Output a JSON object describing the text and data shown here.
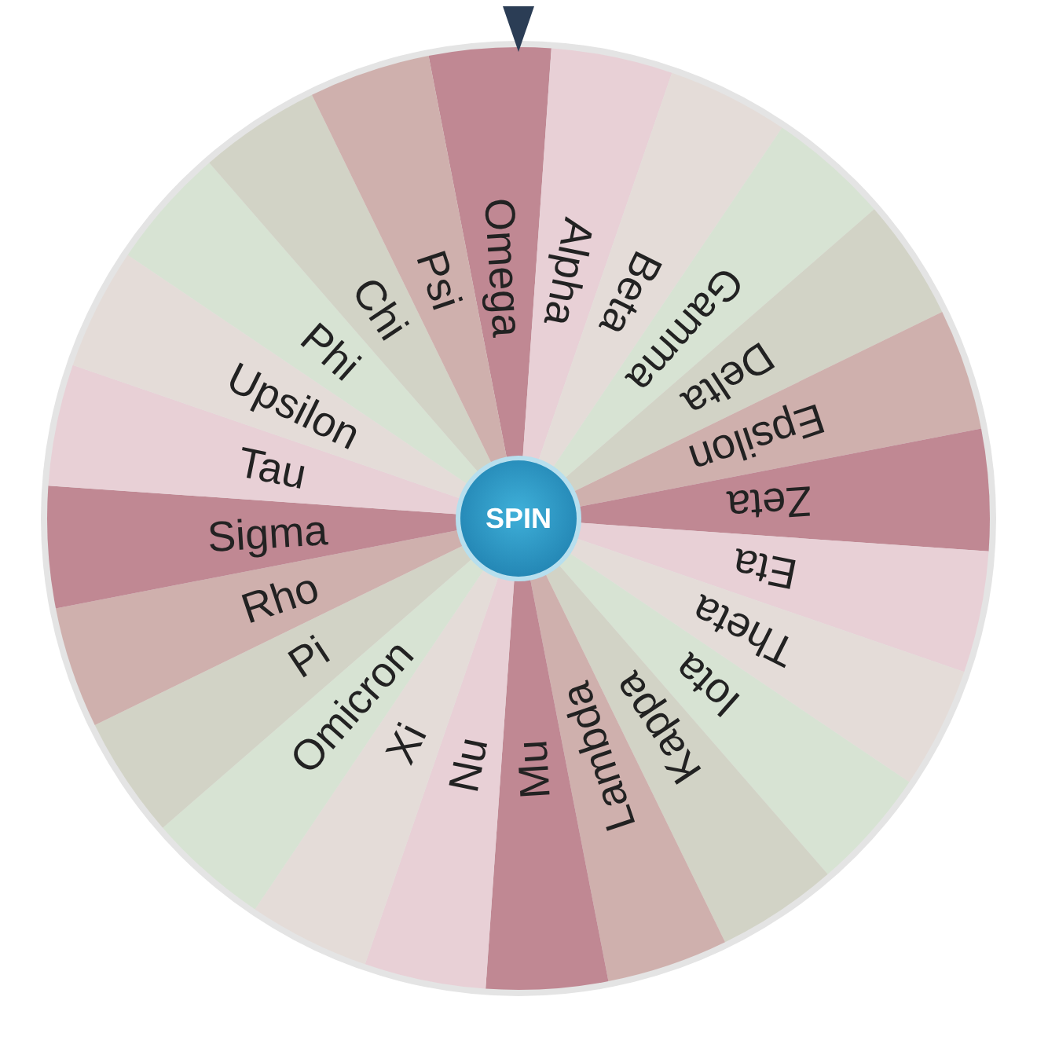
{
  "spin_button": {
    "label": "SPIN"
  },
  "segments": [
    {
      "label": "Omega",
      "color": "#c08893"
    },
    {
      "label": "Alpha",
      "color": "#e8d0d6"
    },
    {
      "label": "Beta",
      "color": "#e4dcd8"
    },
    {
      "label": "Gamma",
      "color": "#d7e3d3"
    },
    {
      "label": "Delta",
      "color": "#d2d3c6"
    },
    {
      "label": "Epsilon",
      "color": "#cfb0ad"
    },
    {
      "label": "Zeta",
      "color": "#c08893"
    },
    {
      "label": "Eta",
      "color": "#e8d0d6"
    },
    {
      "label": "Theta",
      "color": "#e4dcd8"
    },
    {
      "label": "Iota",
      "color": "#d7e3d3"
    },
    {
      "label": "Kappa",
      "color": "#d2d3c6"
    },
    {
      "label": "Lambda",
      "color": "#cfb0ad"
    },
    {
      "label": "Mu",
      "color": "#c08893"
    },
    {
      "label": "Nu",
      "color": "#e8d0d6"
    },
    {
      "label": "Xi",
      "color": "#e4dcd8"
    },
    {
      "label": "Omicron",
      "color": "#d7e3d3"
    },
    {
      "label": "Pi",
      "color": "#d2d3c6"
    },
    {
      "label": "Rho",
      "color": "#cfb0ad"
    },
    {
      "label": "Sigma",
      "color": "#c08893"
    },
    {
      "label": "Tau",
      "color": "#e8d0d6"
    },
    {
      "label": "Upsilon",
      "color": "#e4dcd8"
    },
    {
      "label": "Phi",
      "color": "#d7e3d3"
    },
    {
      "label": "Chi",
      "color": "#d2d3c6"
    },
    {
      "label": "Psi",
      "color": "#cfb0ad"
    }
  ]
}
